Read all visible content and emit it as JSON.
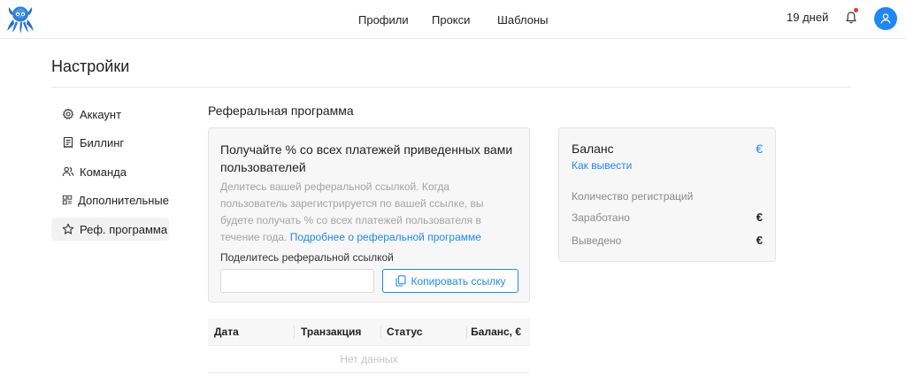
{
  "header": {
    "nav": [
      {
        "label": "Профили"
      },
      {
        "label": "Прокси"
      },
      {
        "label": "Шаблоны"
      }
    ],
    "days_left": "19 дней",
    "accent_color": "#1e88f5",
    "notification_dot_color": "#e53935"
  },
  "page": {
    "title": "Настройки"
  },
  "sidebar": {
    "items": [
      {
        "label": "Аккаунт",
        "icon": "gear-icon"
      },
      {
        "label": "Биллинг",
        "icon": "receipt-icon"
      },
      {
        "label": "Команда",
        "icon": "team-icon"
      },
      {
        "label": "Дополнительные",
        "icon": "grid-icon"
      },
      {
        "label": "Реф. программа",
        "icon": "star-icon",
        "active": true
      }
    ]
  },
  "referral": {
    "section_title": "Реферальная программа",
    "heading": "Получайте % со всех платежей приведенных вами пользователей",
    "description": "Делитесь вашей реферальной ссылкой. Когда пользователь зарегистрируется по вашей ссылке, вы будете получать % со всех платежей пользователя в течение года.",
    "more_link": "Подробнее о реферальной программе",
    "share_label": "Поделитесь реферальной ссылкой",
    "share_value": "",
    "copy_button": "Копировать ссылку"
  },
  "table": {
    "columns": [
      "Дата",
      "Транзакция",
      "Статус",
      "Баланс, €"
    ],
    "empty_text": "Нет данных"
  },
  "balance": {
    "title": "Баланс",
    "currency_symbol": "€",
    "how_to_withdraw": "Как вывести",
    "stats": [
      {
        "label": "Количество регистраций",
        "value": ""
      },
      {
        "label": "Заработано",
        "value": "€"
      },
      {
        "label": "Выведено",
        "value": "€"
      }
    ]
  }
}
